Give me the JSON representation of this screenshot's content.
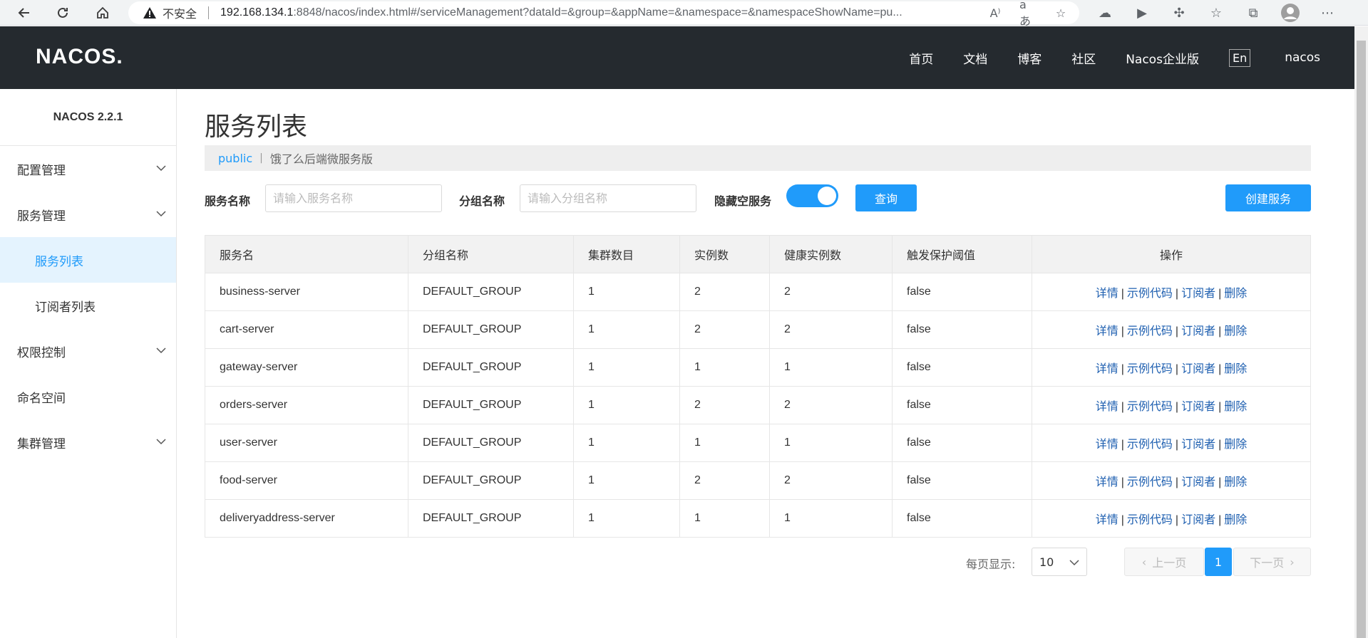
{
  "browser": {
    "insecure_label": "不安全",
    "url_host": "192.168.134.1",
    "url_rest": ":8848/nacos/index.html#/serviceManagement?dataId=&group=&appName=&namespace=&namespaceShowName=pu..."
  },
  "header": {
    "logo": "NACOS.",
    "nav": [
      "首页",
      "文档",
      "博客",
      "社区",
      "Nacos企业版"
    ],
    "lang": "En",
    "user": "nacos"
  },
  "sidebar": {
    "version": "NACOS 2.2.1",
    "items": [
      {
        "label": "配置管理"
      },
      {
        "label": "服务管理"
      },
      {
        "label": "服务列表"
      },
      {
        "label": "订阅者列表"
      },
      {
        "label": "权限控制"
      },
      {
        "label": "命名空间"
      },
      {
        "label": "集群管理"
      }
    ]
  },
  "main": {
    "title": "服务列表",
    "namespace": "public",
    "namespace_name": "饿了么后端微服务版",
    "search": {
      "service_label": "服务名称",
      "service_placeholder": "请输入服务名称",
      "group_label": "分组名称",
      "group_placeholder": "请输入分组名称",
      "hide_empty_label": "隐藏空服务",
      "hide_empty_on": true,
      "query_button": "查询",
      "create_button": "创建服务"
    },
    "table": {
      "headers": [
        "服务名",
        "分组名称",
        "集群数目",
        "实例数",
        "健康实例数",
        "触发保护阈值",
        "操作"
      ],
      "actions": [
        "详情",
        "示例代码",
        "订阅者",
        "删除"
      ],
      "rows": [
        [
          "business-server",
          "DEFAULT_GROUP",
          "1",
          "2",
          "2",
          "false"
        ],
        [
          "cart-server",
          "DEFAULT_GROUP",
          "1",
          "2",
          "2",
          "false"
        ],
        [
          "gateway-server",
          "DEFAULT_GROUP",
          "1",
          "1",
          "1",
          "false"
        ],
        [
          "orders-server",
          "DEFAULT_GROUP",
          "1",
          "2",
          "2",
          "false"
        ],
        [
          "user-server",
          "DEFAULT_GROUP",
          "1",
          "1",
          "1",
          "false"
        ],
        [
          "food-server",
          "DEFAULT_GROUP",
          "1",
          "2",
          "2",
          "false"
        ],
        [
          "deliveryaddress-server",
          "DEFAULT_GROUP",
          "1",
          "1",
          "1",
          "false"
        ]
      ]
    },
    "pagination": {
      "per_page_label": "每页显示:",
      "per_page": "10",
      "prev": "上一页",
      "current": "1",
      "next": "下一页"
    }
  }
}
